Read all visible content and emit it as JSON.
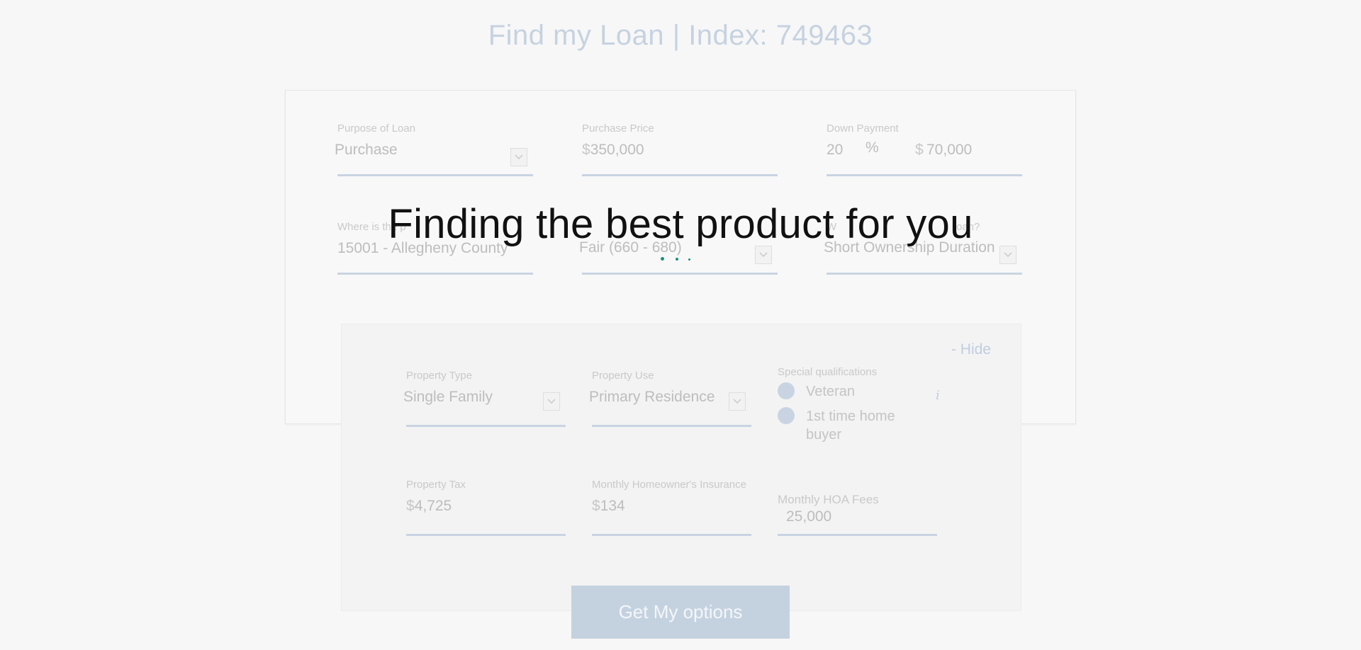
{
  "page": {
    "title": "Find my Loan | Index: 749463"
  },
  "form": {
    "purpose": {
      "label": "Purpose of Loan",
      "value": "Purchase"
    },
    "purchase_price": {
      "label": "Purchase Price",
      "currency": "$",
      "value": "350,000"
    },
    "down_payment": {
      "label": "Down Payment",
      "percent": "20",
      "percent_symbol": "%",
      "currency": "$",
      "amount": "70,000"
    },
    "location": {
      "label_visible": "Where is the p",
      "value": "15001 - Allegheny County"
    },
    "credit": {
      "label_visible": "",
      "value": "Fair (660 - 680)"
    },
    "goal": {
      "label_visible": "W",
      "label_tail": "oan?",
      "value": "Short Ownership Duration"
    }
  },
  "details": {
    "hide_link": "- Hide",
    "property_type": {
      "label": "Property Type",
      "value": "Single Family"
    },
    "property_use": {
      "label": "Property Use",
      "value": "Primary Residence"
    },
    "special": {
      "label": "Special qualifications",
      "options": [
        "Veteran",
        "1st time home buyer"
      ],
      "info_icon": "i"
    },
    "property_tax": {
      "label": "Property Tax",
      "currency": "$",
      "value": "4,725"
    },
    "insurance": {
      "label": "Monthly Homeowner's Insurance",
      "currency": "$",
      "value": "134"
    },
    "hoa": {
      "label": "Monthly HOA Fees",
      "value": "25,000"
    }
  },
  "cta": {
    "label": "Get My options"
  },
  "overlay": {
    "message": "Finding the best product for you"
  },
  "colors": {
    "accent": "#c4d2e0",
    "underline": "#c9d4e2",
    "loader": "#1a8f7c",
    "overlay_text": "#111111"
  }
}
